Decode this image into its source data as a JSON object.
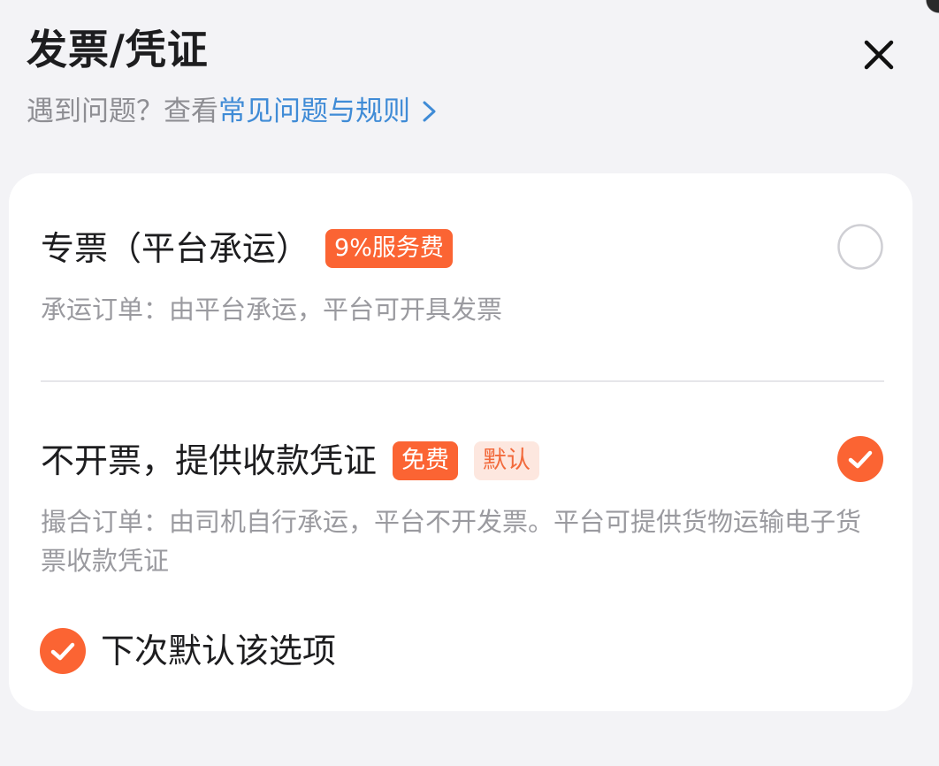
{
  "header": {
    "title": "发票/凭证",
    "help_prefix": "遇到问题？查看",
    "help_link": "常见问题与规则"
  },
  "options": [
    {
      "title": "专票（平台承运）",
      "badges": [
        "9%服务费"
      ],
      "description": "承运订单：由平台承运，平台可开具发票",
      "selected": false
    },
    {
      "title": "不开票，提供收款凭证",
      "badges": [
        "免费",
        "默认"
      ],
      "description": "撮合订单：由司机自行承运，平台不开发票。平台可提供货物运输电子货票收款凭证",
      "selected": true
    }
  ],
  "remember": {
    "label": "下次默认该选项",
    "checked": true
  },
  "colors": {
    "accent": "#fb6433",
    "link": "#3f8bd6",
    "muted_text": "#9a9a9f",
    "badge_light_bg": "#fde7df"
  },
  "icons": {
    "close": "close-icon",
    "help_chevron": "chevron-right-icon",
    "radio_unchecked": "radio-unchecked-icon",
    "radio_checked": "radio-checked-icon",
    "checkbox_checked": "checkbox-checked-icon"
  }
}
